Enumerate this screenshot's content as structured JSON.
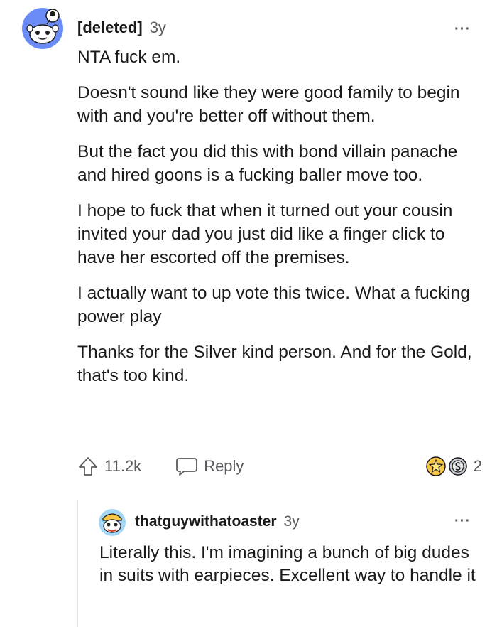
{
  "comment": {
    "author": "[deleted]",
    "age": "3y",
    "more_icon": "···",
    "paragraphs": [
      "NTA fuck em.",
      "Doesn't sound like they were good family to begin with and you're better off without them.",
      "But the fact you did this with bond villain panache and hired goons is a fucking baller move too.",
      "I hope to fuck that when it turned out your cousin invited your dad you just did like a finger click to have her escorted off the premises.",
      "I actually want to up vote this twice. What a fucking power play",
      "Thanks for the Silver kind person. And for the Gold, that's too kind."
    ],
    "vote_count": "11.2k",
    "reply_label": "Reply",
    "award_count": "2"
  },
  "reply": {
    "author": "thatguywithatoaster",
    "age": "3y",
    "more_icon": "···",
    "text": "Literally this. I'm imagining a bunch of big dudes in suits with earpieces. Excellent way to handle it"
  },
  "colors": {
    "text": "#1a1a1b",
    "meta": "#57595c",
    "avatar_bg": "#6b8cf6",
    "gold": "#f6c644",
    "silver": "#c9ccd1"
  }
}
